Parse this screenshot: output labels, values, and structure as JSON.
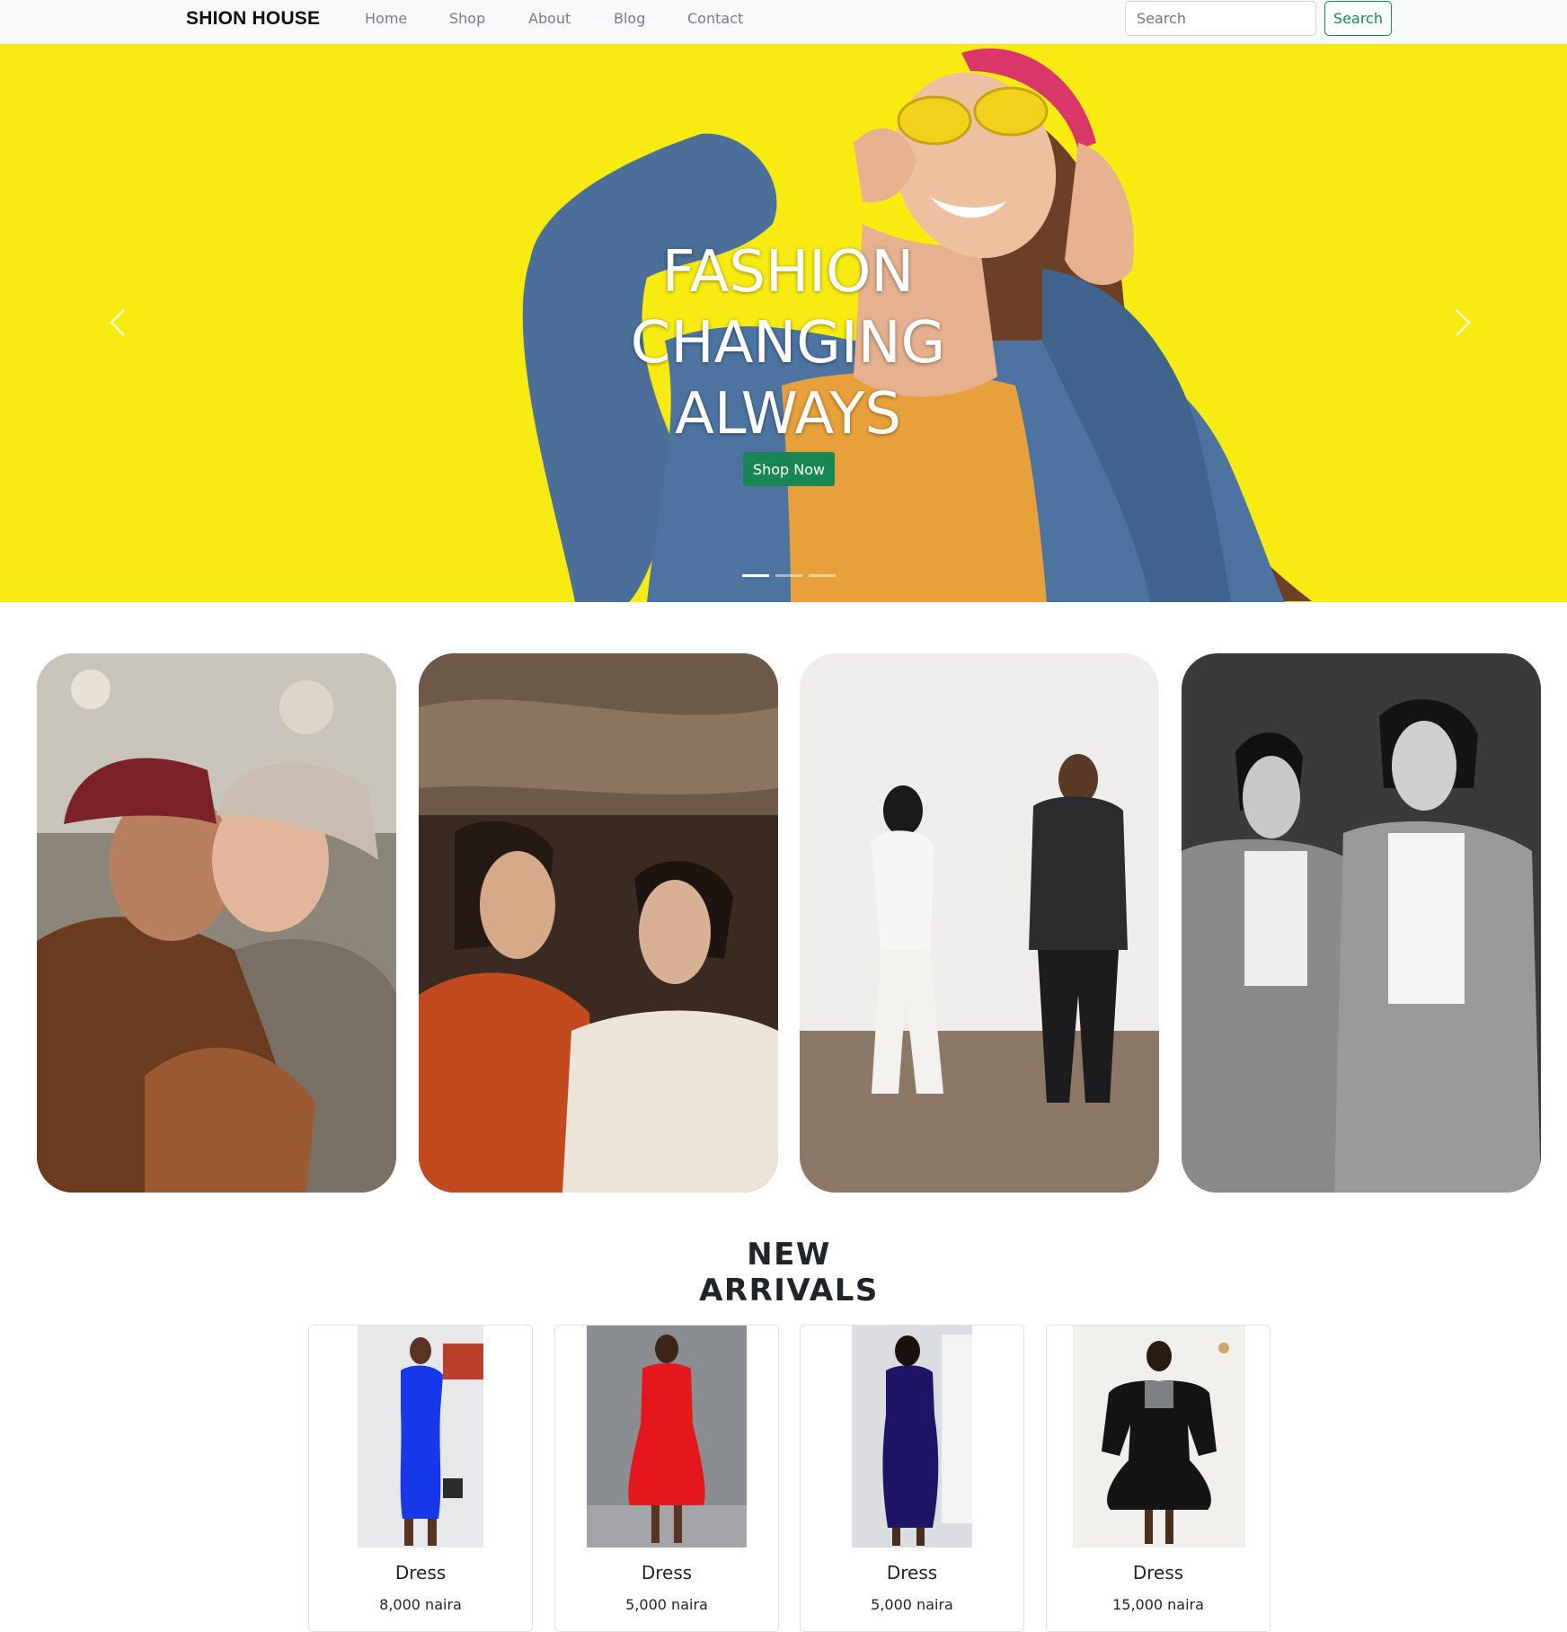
{
  "navbar": {
    "brand": "SHION HOUSE",
    "links": [
      "Home",
      "Shop",
      "About",
      "Blog",
      "Contact"
    ],
    "search_placeholder": "Search",
    "search_button": "Search"
  },
  "hero": {
    "title_lines": [
      "FASHION",
      "CHANGING",
      "ALWAYS"
    ],
    "cta": "Shop Now",
    "slide_count": 3,
    "active_slide": 1,
    "background_color": "#f8eb12"
  },
  "gallery": {
    "photos": [
      "couple-in-winter-hats",
      "two-women-in-blazers",
      "couple-in-studio",
      "two-men-in-suits-bw"
    ]
  },
  "new_arrivals": {
    "title": "NEW ARRIVALS",
    "products": [
      {
        "name": "Dress",
        "price": "8,000 naira",
        "color": "#1638e8"
      },
      {
        "name": "Dress",
        "price": "5,000 naira",
        "color": "#e4181c"
      },
      {
        "name": "Dress",
        "price": "5,000 naira",
        "color": "#1e1466"
      },
      {
        "name": "Dress",
        "price": "15,000 naira",
        "color": "#141414"
      }
    ]
  },
  "colors": {
    "accent": "#198754",
    "navbar_bg": "#f8f9fa"
  }
}
